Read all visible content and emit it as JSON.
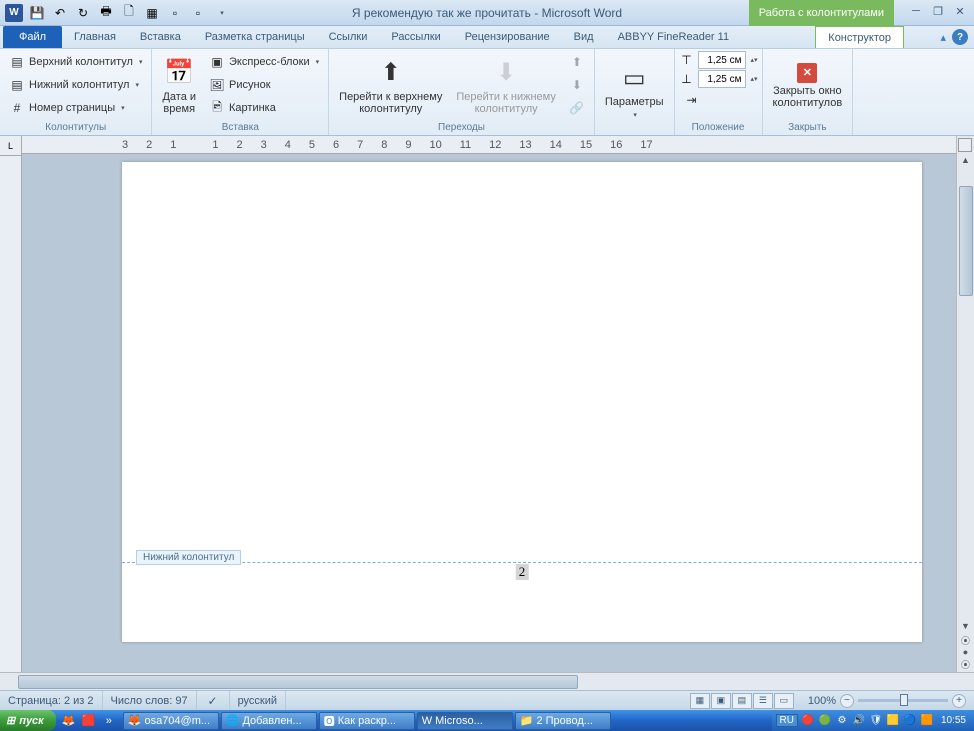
{
  "title": "Я рекомендую так же прочитать - Microsoft Word",
  "contextual_title": "Работа с колонтитулами",
  "tabs": {
    "file": "Файл",
    "home": "Главная",
    "insert": "Вставка",
    "layout": "Разметка страницы",
    "refs": "Ссылки",
    "mailings": "Рассылки",
    "review": "Рецензирование",
    "view": "Вид",
    "abbyy": "ABBYY FineReader 11",
    "designer": "Конструктор"
  },
  "ribbon": {
    "g1": {
      "header": "Верхний колонтитул",
      "footer": "Нижний колонтитул",
      "pagenum": "Номер страницы",
      "label": "Колонтитулы"
    },
    "g2": {
      "datetime_l1": "Дата и",
      "datetime_l2": "время",
      "quickparts": "Экспресс-блоки",
      "picture": "Рисунок",
      "clipart": "Картинка",
      "label": "Вставка"
    },
    "g3": {
      "gotoheader_l1": "Перейти к верхнему",
      "gotoheader_l2": "колонтитулу",
      "gotofooter_l1": "Перейти к нижнему",
      "gotofooter_l2": "колонтитулу",
      "label": "Переходы"
    },
    "g4": {
      "options": "Параметры",
      "label": ""
    },
    "g5": {
      "top": "1,25 см",
      "bottom": "1,25 см",
      "label": "Положение"
    },
    "g6": {
      "close_l1": "Закрыть окно",
      "close_l2": "колонтитулов",
      "label": "Закрыть"
    }
  },
  "doc": {
    "footer_tag": "Нижний колонтитул",
    "page_number": "2"
  },
  "status": {
    "page": "Страница: 2 из 2",
    "words": "Число слов: 97",
    "lang": "русский",
    "zoom": "100%"
  },
  "taskbar": {
    "start": "пуск",
    "t1": "osa704@m...",
    "t2": "Добавлен...",
    "t3": "Как раскр...",
    "t4": "Microso...",
    "t5": "2 Провод...",
    "lang": "RU",
    "clock": "10:55"
  },
  "ruler": [
    "3",
    "2",
    "1",
    "",
    "1",
    "2",
    "3",
    "4",
    "5",
    "6",
    "7",
    "8",
    "9",
    "10",
    "11",
    "12",
    "13",
    "14",
    "15",
    "16",
    "17"
  ]
}
